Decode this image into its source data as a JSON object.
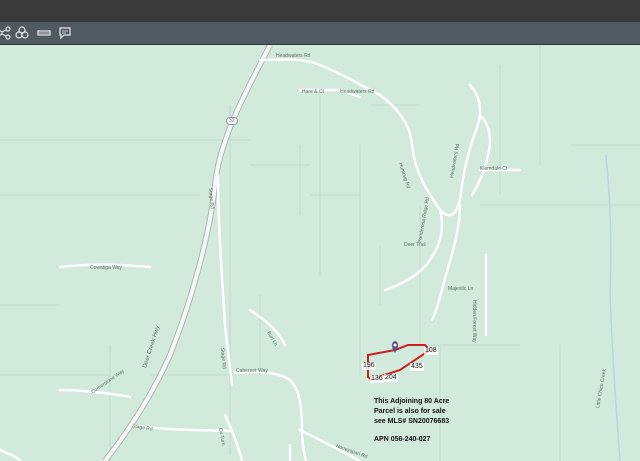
{
  "toolbar": {
    "icons": [
      "share-icon",
      "layers-icon",
      "measure-icon",
      "comment-icon"
    ]
  },
  "map": {
    "roads": {
      "headwaters_rd_1": "Headwaters Rd",
      "headwaters_rd_2": "Headwaters Rd",
      "hare_ct": "Hare & Ct",
      "route_32": "32",
      "deer_creek_hwy": "Deer Creek Hwy",
      "humbug_rd": "Humbug Rd",
      "cowatiga_way": "Cowatiga Way",
      "stage_rd": "Stage Rd",
      "stage_rd_2": "Stage Rd",
      "deer_trail": "Deer Trail",
      "ponderosa_ridge_rd": "Ponderosa Ridge Rd",
      "headwaters_rd_3": "Headwaters Rd",
      "klemdale_ct": "Klemdale Ct",
      "hidden_forest_way": "Hidden Forest Way",
      "majestic_ln": "Majestic Ln",
      "burl_ln": "Burl Ln",
      "cabernet_way": "Cabernet Way",
      "ox_turn": "Ox Turn",
      "stage_rd_3": "Stage Rd",
      "cornerstone_way": "Cornerstone Way",
      "little_chico_creek": "Little Chico Creek",
      "honeyspan_rd": "Honeyspan Rd"
    },
    "parcel_dimensions": [
      "196",
      "136",
      "204",
      "435",
      "108"
    ],
    "parcel_color": "#cc1f1f",
    "note": {
      "line1": "This Adjoining 80 Acre",
      "line2": "Parcel is also for sale",
      "line3": "see MLS# SN20076683",
      "apn": "APN 056-240-027"
    }
  }
}
